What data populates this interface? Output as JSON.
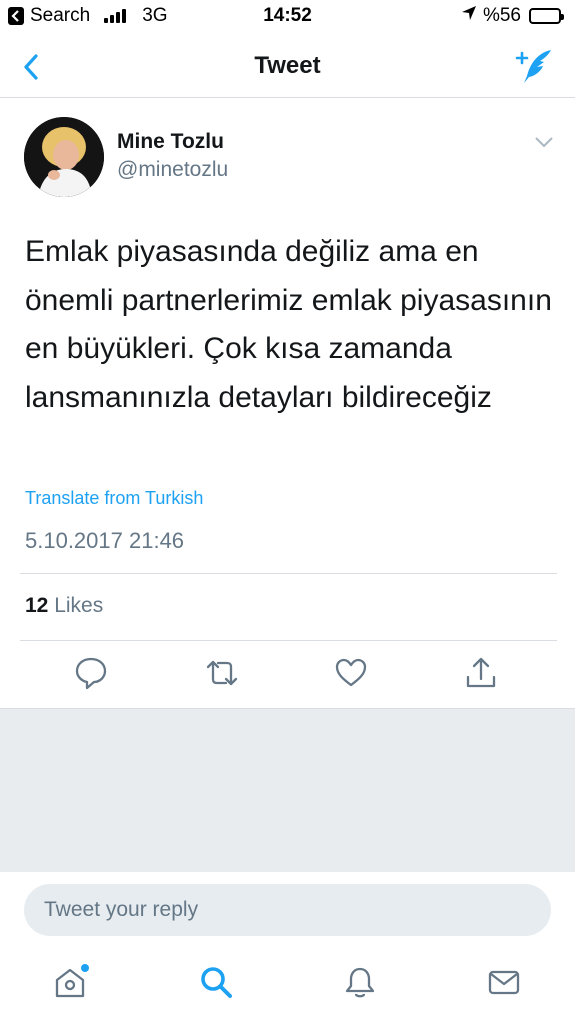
{
  "status_bar": {
    "back_app": "Search",
    "network": "3G",
    "time": "14:52",
    "battery": "%56",
    "battery_level": 0.56
  },
  "nav": {
    "title": "Tweet"
  },
  "tweet": {
    "author_name": "Mine Tozlu",
    "author_handle": "@minetozlu",
    "text": "Emlak piyasasında değiliz ama en önemli partnerlerimiz emlak piyasasının en büyükleri. Çok kısa zamanda lansmanınızla detayları bildireceğiz",
    "translate_label": "Translate from Turkish",
    "timestamp": "5.10.2017 21:46",
    "likes_count": "12",
    "likes_label": "Likes"
  },
  "reply": {
    "placeholder": "Tweet your reply"
  },
  "colors": {
    "accent": "#1da1f2",
    "secondary_text": "#657786",
    "divider": "#d9dde1"
  },
  "tabbar": {
    "icons": [
      "home-icon",
      "search-icon",
      "notifications-icon",
      "messages-icon"
    ]
  }
}
